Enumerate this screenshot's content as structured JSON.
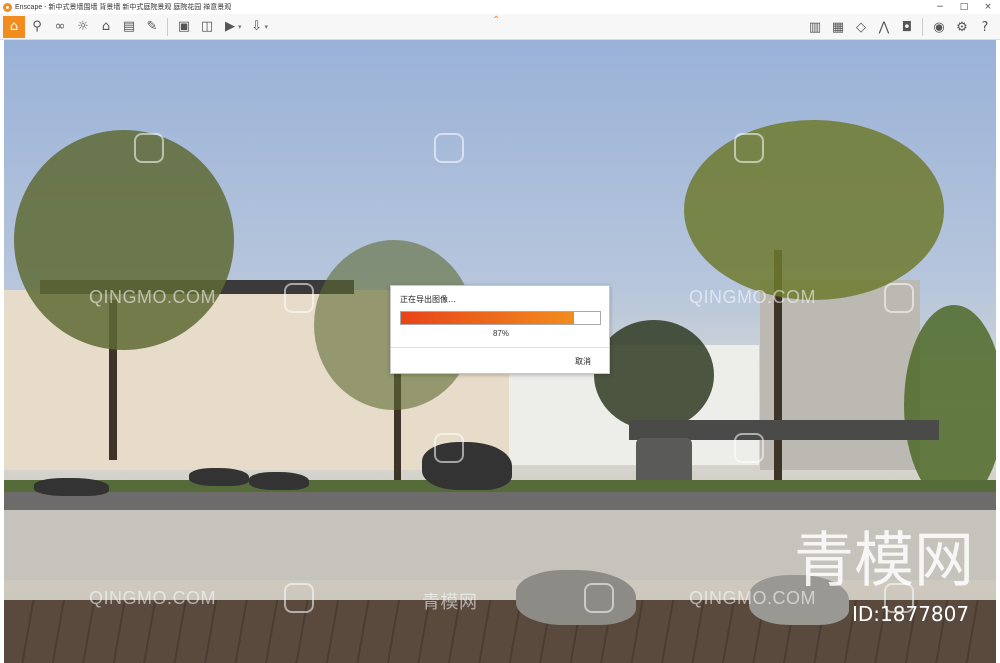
{
  "window": {
    "title": "Enscape - 新中式景墙围墙 背景墙 新中式庭院景观 庭院花园 禅意景观",
    "controls": {
      "help": "?",
      "minimize": "−",
      "maximize": "□",
      "close": "×"
    }
  },
  "toolbar": {
    "accent_color": "#f28c1e",
    "left_icons": [
      "home-icon",
      "map-icon",
      "binoculars-icon",
      "sun-icon",
      "house-icon",
      "layers-icon",
      "brush-icon",
      "screenshot-icon",
      "panorama-icon",
      "video-icon",
      "export-icon"
    ],
    "right_icons": [
      "book-icon",
      "gallery-icon",
      "cube-icon",
      "chart-icon",
      "vr-headset-icon",
      "eye-icon",
      "gear-icon",
      "help-icon"
    ]
  },
  "watermarks": {
    "site": "QINGMO.COM",
    "site_cn": "青模网",
    "brand": "青模网",
    "id": "ID:1877807"
  },
  "dialog": {
    "title": "正在导出图像…",
    "progress": 0.87,
    "percent_label": "87%",
    "cancel_label": "取消"
  }
}
